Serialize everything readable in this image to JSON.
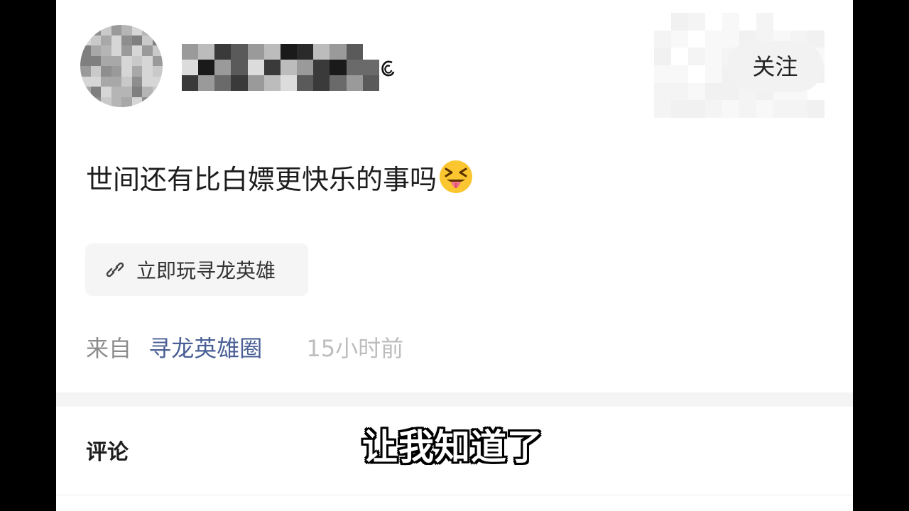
{
  "post": {
    "text": "世间还有比白嫖更快乐的事吗",
    "emoji": "squinting-face-with-tongue"
  },
  "header": {
    "follow_label": "关注"
  },
  "link_card": {
    "icon": "link-icon",
    "label": "立即玩寻龙英雄"
  },
  "meta": {
    "from_label": "来自",
    "circle_name": "寻龙英雄圈",
    "time": "15小时前"
  },
  "comments": {
    "label": "评论"
  },
  "subtitle": {
    "text": "让我知道了"
  }
}
